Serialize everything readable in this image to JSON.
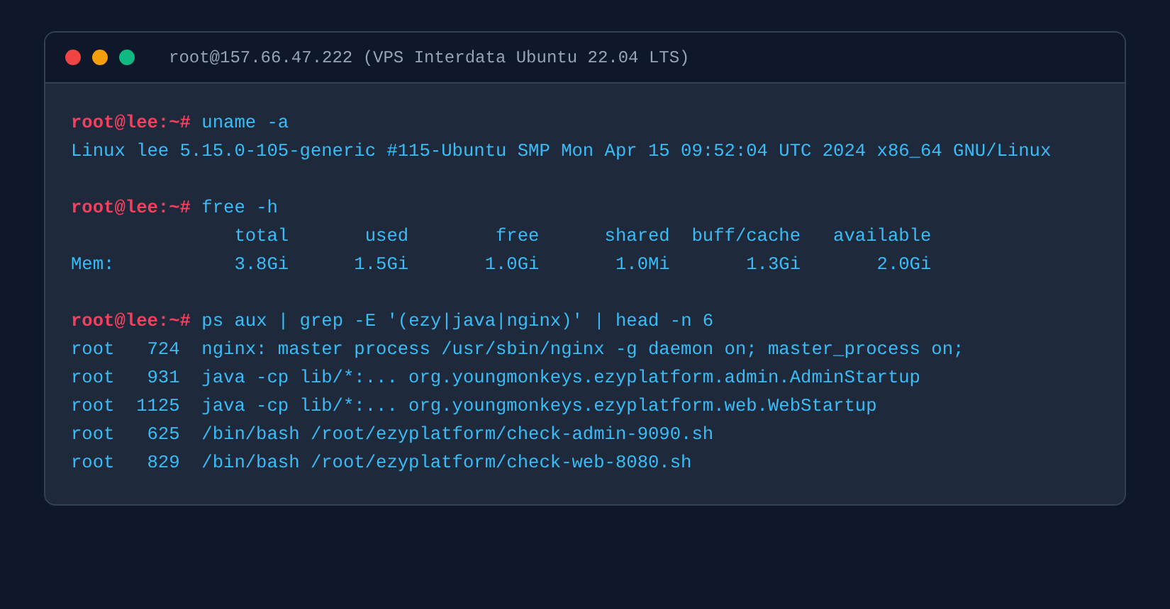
{
  "window": {
    "title": "root@157.66.47.222 (VPS Interdata Ubuntu 22.04 LTS)"
  },
  "blocks": [
    {
      "prompt": "root@lee:~#",
      "command": "uname -a",
      "output": [
        "Linux lee 5.15.0-105-generic #115-Ubuntu SMP Mon Apr 15 09:52:04 UTC 2024 x86_64 GNU/Linux"
      ]
    },
    {
      "prompt": "root@lee:~#",
      "command": "free -h",
      "output": [
        "               total       used        free      shared  buff/cache   available",
        "Mem:           3.8Gi      1.5Gi       1.0Gi       1.0Mi       1.3Gi       2.0Gi"
      ]
    },
    {
      "prompt": "root@lee:~#",
      "command": "ps aux | grep -E '(ezy|java|nginx)' | head -n 6",
      "output": [
        "root   724  nginx: master process /usr/sbin/nginx -g daemon on; master_process on;",
        "root   931  java -cp lib/*:... org.youngmonkeys.ezyplatform.admin.AdminStartup",
        "root  1125  java -cp lib/*:... org.youngmonkeys.ezyplatform.web.WebStartup",
        "root   625  /bin/bash /root/ezyplatform/check-admin-9090.sh",
        "root   829  /bin/bash /root/ezyplatform/check-web-8080.sh"
      ]
    }
  ]
}
